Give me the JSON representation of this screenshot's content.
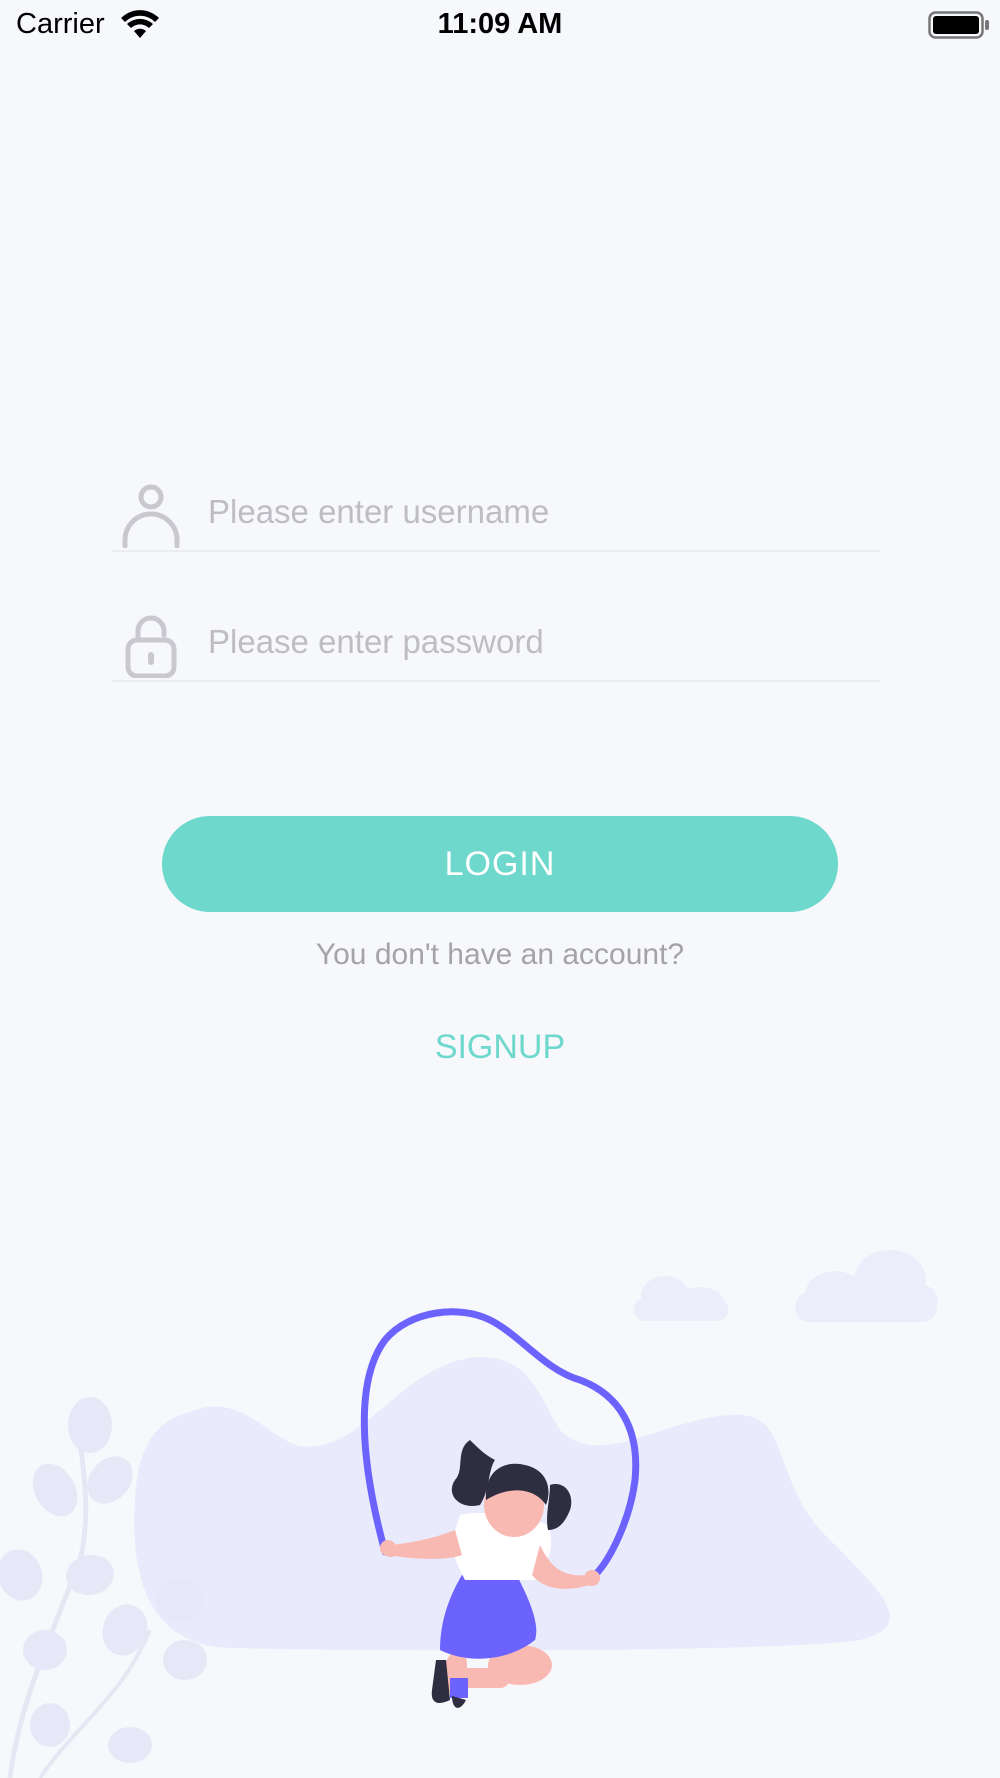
{
  "status_bar": {
    "carrier": "Carrier",
    "time": "11:09 AM"
  },
  "form": {
    "username_placeholder": "Please enter username",
    "password_placeholder": "Please enter password"
  },
  "actions": {
    "login_label": "LOGIN",
    "no_account_text": "You don't have an account?",
    "signup_label": "SIGNUP"
  },
  "icons": {
    "username": "user-icon",
    "password": "unlock-icon",
    "wifi": "wifi-icon",
    "battery": "battery-icon"
  },
  "colors": {
    "background": "#F7F8FC",
    "accent": "#6ED8CD",
    "placeholder": "#BDBDC3",
    "muted_text": "#A3A3A8",
    "illustration_primary": "#6C63FF",
    "illustration_blob": "#E9EAFB"
  }
}
